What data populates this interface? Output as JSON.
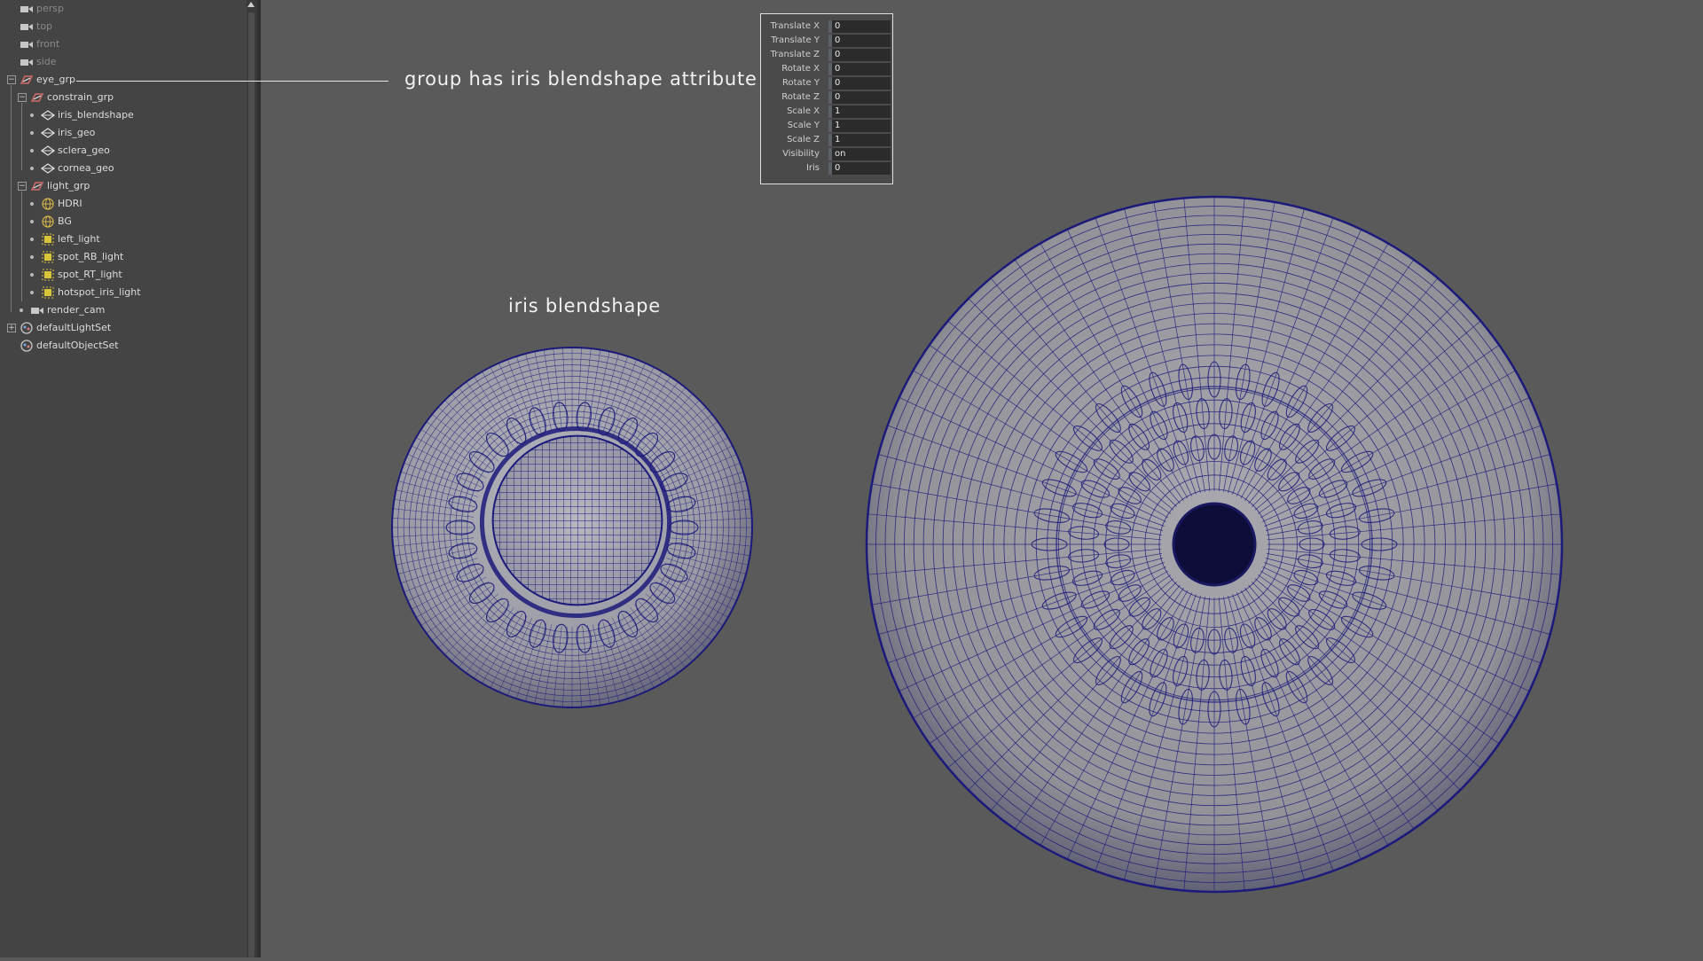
{
  "outliner": {
    "items": [
      {
        "label": "persp",
        "icon": "camera-icon",
        "indent": 0,
        "dim": true
      },
      {
        "label": "top",
        "icon": "camera-icon",
        "indent": 0,
        "dim": true
      },
      {
        "label": "front",
        "icon": "camera-icon",
        "indent": 0,
        "dim": true
      },
      {
        "label": "side",
        "icon": "camera-icon",
        "indent": 0,
        "dim": true
      },
      {
        "label": "eye_grp",
        "icon": "group-icon",
        "indent": 0,
        "expander": "minus"
      },
      {
        "label": "constrain_grp",
        "icon": "group-icon",
        "indent": 1,
        "expander": "minus"
      },
      {
        "label": "iris_blendshape",
        "icon": "mesh-icon",
        "indent": 2
      },
      {
        "label": "iris_geo",
        "icon": "mesh-icon",
        "indent": 2
      },
      {
        "label": "sclera_geo",
        "icon": "mesh-icon",
        "indent": 2
      },
      {
        "label": "cornea_geo",
        "icon": "mesh-icon",
        "indent": 2
      },
      {
        "label": "light_grp",
        "icon": "group-icon",
        "indent": 1,
        "expander": "minus"
      },
      {
        "label": "HDRI",
        "icon": "globe-icon",
        "indent": 2
      },
      {
        "label": "BG",
        "icon": "globe-icon",
        "indent": 2
      },
      {
        "label": "left_light",
        "icon": "light-icon",
        "indent": 2
      },
      {
        "label": "spot_RB_light",
        "icon": "light-icon",
        "indent": 2
      },
      {
        "label": "spot_RT_light",
        "icon": "light-icon",
        "indent": 2
      },
      {
        "label": "hotspot_iris_light",
        "icon": "light-icon",
        "indent": 2
      },
      {
        "label": "render_cam",
        "icon": "camera-icon",
        "indent": 1
      },
      {
        "label": "defaultLightSet",
        "icon": "set-icon",
        "indent": 0,
        "expander": "plus"
      },
      {
        "label": "defaultObjectSet",
        "icon": "set-icon",
        "indent": 0
      }
    ]
  },
  "annotations": {
    "group_note": "group has iris blendshape attribute",
    "blendshape_note": "iris blendshape"
  },
  "channel_box": {
    "channels": [
      {
        "label": "Translate X",
        "value": "0"
      },
      {
        "label": "Translate Y",
        "value": "0"
      },
      {
        "label": "Translate Z",
        "value": "0"
      },
      {
        "label": "Rotate X",
        "value": "0"
      },
      {
        "label": "Rotate Y",
        "value": "0"
      },
      {
        "label": "Rotate Z",
        "value": "0"
      },
      {
        "label": "Scale X",
        "value": "1"
      },
      {
        "label": "Scale Y",
        "value": "1"
      },
      {
        "label": "Scale Z",
        "value": "1"
      },
      {
        "label": "Visibility",
        "value": "on"
      },
      {
        "label": "Iris",
        "value": "0"
      }
    ]
  },
  "colors": {
    "wire": "#1c1a7a",
    "shade": "#a0a0a8",
    "viewport_bg": "#5a5a5a",
    "group_icon": "#d06a6a",
    "light_icon": "#d8c53a"
  }
}
